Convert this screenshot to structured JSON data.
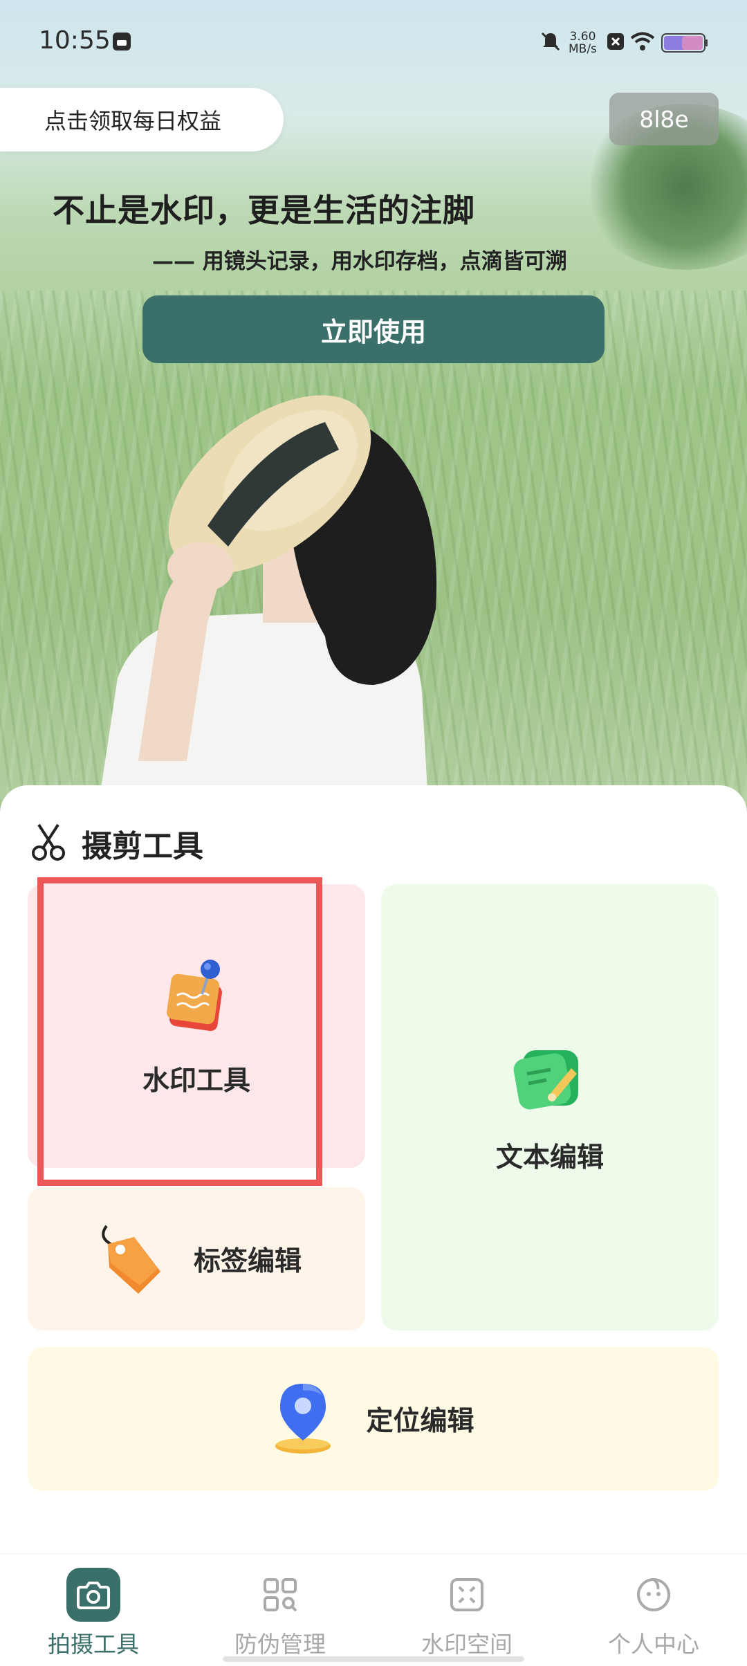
{
  "status_bar": {
    "time": "10:55",
    "net_speed_value": "3.60",
    "net_speed_unit": "MB/s",
    "icons": [
      "notification-card-icon",
      "mute-icon",
      "close-box-icon",
      "wifi-icon",
      "battery-icon"
    ]
  },
  "hero": {
    "daily_reward": "点击领取每日权益",
    "code_badge": "8l8e",
    "title": "不止是水印，更是生活的注脚",
    "subtitle": "—— 用镜头记录，用水印存档，点滴皆可溯",
    "cta": "立即使用"
  },
  "tools": {
    "section_title": "摄剪工具",
    "cards": {
      "watermark": "水印工具",
      "text_edit": "文本编辑",
      "tag_edit": "标签编辑",
      "location_edit": "定位编辑"
    }
  },
  "nav": {
    "items": [
      {
        "label": "拍摄工具",
        "icon": "camera-icon",
        "active": true
      },
      {
        "label": "防伪管理",
        "icon": "qr-scan-icon",
        "active": false
      },
      {
        "label": "水印空间",
        "icon": "focus-frame-icon",
        "active": false
      },
      {
        "label": "个人中心",
        "icon": "smile-face-icon",
        "active": false
      }
    ]
  },
  "colors": {
    "accent": "#3b6f6a",
    "highlight": "#ee5757",
    "watermark_card": "#fde7e8",
    "text_card": "#eefaea",
    "tag_card": "#fff4ea",
    "location_card": "#fffae4"
  }
}
